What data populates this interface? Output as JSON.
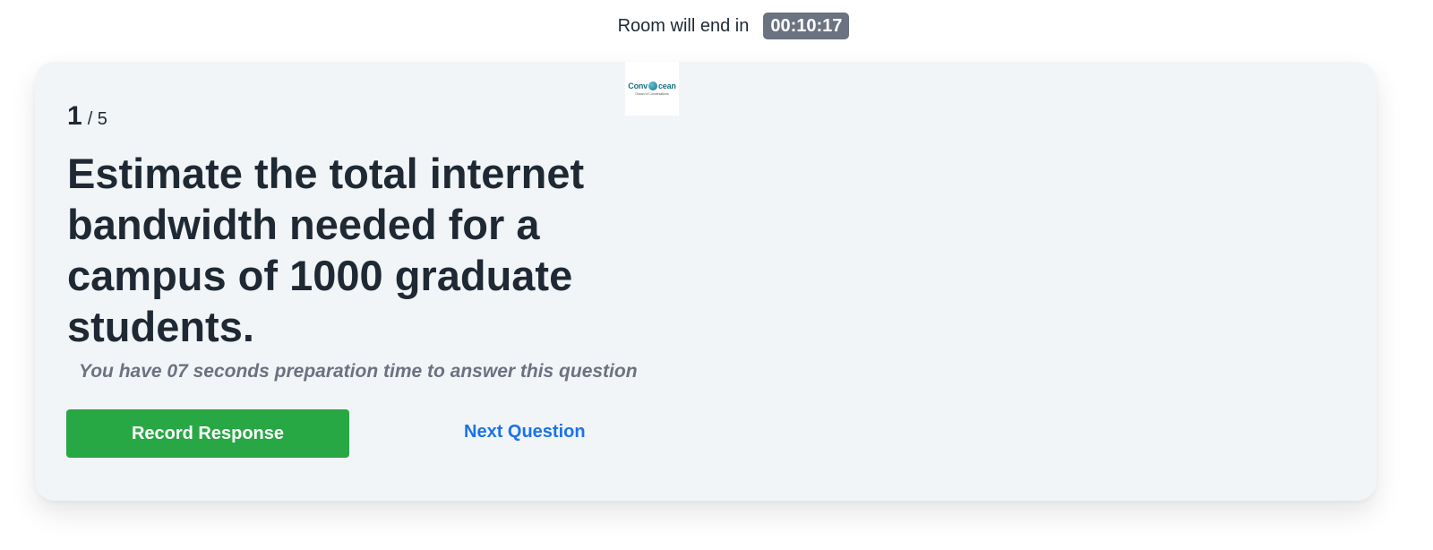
{
  "header": {
    "timer_label": "Room will end in",
    "timer_value": "00:10:17"
  },
  "logo": {
    "text_left": "Conv",
    "text_right": "cean",
    "tagline": "Ocean of Conversations",
    "icon": "globe-icon"
  },
  "question": {
    "current": "1",
    "total_label": "/ 5",
    "text": "Estimate the total internet bandwidth needed for a campus of 1000 graduate students.",
    "prep_note": "You have 07 seconds preparation time to answer this question"
  },
  "actions": {
    "record_label": "Record Response",
    "next_label": "Next Question"
  },
  "colors": {
    "primary_button": "#28a745",
    "link": "#1a73e8",
    "timer_badge": "#6b7280",
    "card_background": "#f2f5f8"
  }
}
